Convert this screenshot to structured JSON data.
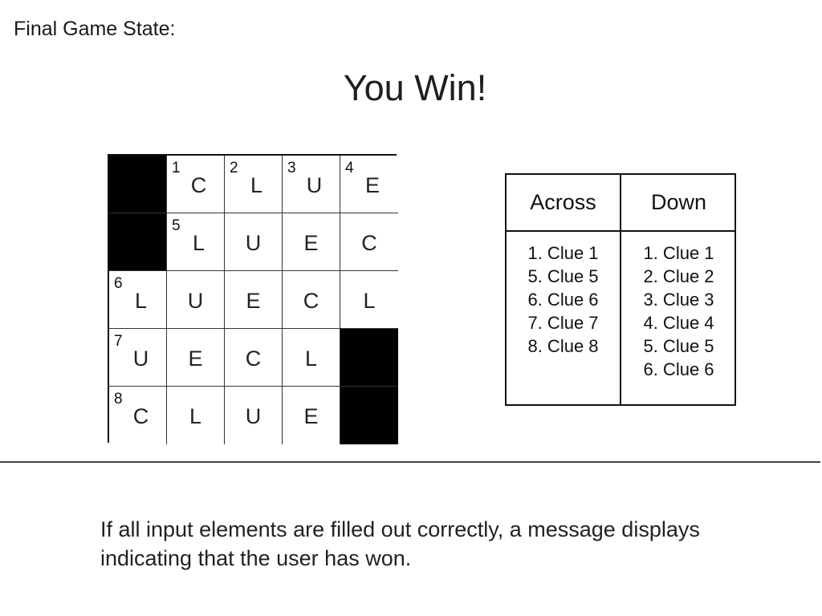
{
  "page": {
    "heading": "Final Game State:",
    "win_message": "You Win!",
    "description": "If all input elements are filled out correctly, a message displays indicating that the user has won."
  },
  "crossword": {
    "colors": {
      "black_cell": "#000000",
      "white_cell": "#ffffff",
      "line": "#333333"
    },
    "rows": [
      [
        {
          "black": true
        },
        {
          "number": "1",
          "letter": "C"
        },
        {
          "number": "2",
          "letter": "L"
        },
        {
          "number": "3",
          "letter": "U"
        },
        {
          "number": "4",
          "letter": "E"
        }
      ],
      [
        {
          "black": true
        },
        {
          "number": "5",
          "letter": "L"
        },
        {
          "letter": "U"
        },
        {
          "letter": "E"
        },
        {
          "letter": "C"
        }
      ],
      [
        {
          "number": "6",
          "letter": "L"
        },
        {
          "letter": "U"
        },
        {
          "letter": "E"
        },
        {
          "letter": "C"
        },
        {
          "letter": "L"
        }
      ],
      [
        {
          "number": "7",
          "letter": "U"
        },
        {
          "letter": "E"
        },
        {
          "letter": "C"
        },
        {
          "letter": "L"
        },
        {
          "black": true
        }
      ],
      [
        {
          "number": "8",
          "letter": "C"
        },
        {
          "letter": "L"
        },
        {
          "letter": "U"
        },
        {
          "letter": "E"
        },
        {
          "black": true
        }
      ]
    ]
  },
  "clues": {
    "across_header": "Across",
    "down_header": "Down",
    "across": [
      "1. Clue 1",
      "5. Clue 5",
      "6. Clue 6",
      "7. Clue 7",
      "8. Clue 8"
    ],
    "down": [
      "1. Clue 1",
      "2. Clue 2",
      "3. Clue 3",
      "4. Clue 4",
      "5. Clue 5",
      "6. Clue 6"
    ]
  }
}
